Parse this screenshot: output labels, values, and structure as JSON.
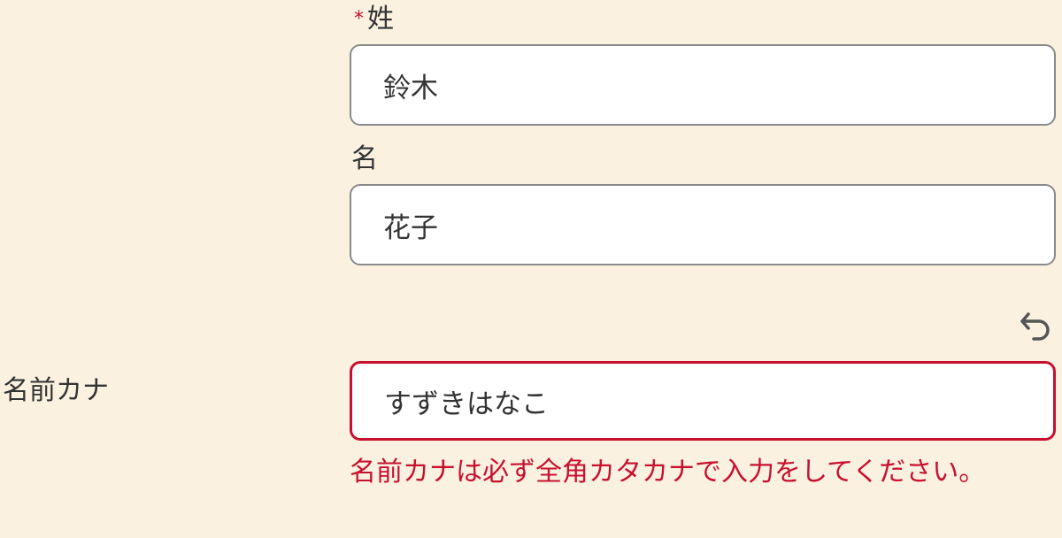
{
  "form": {
    "last_name": {
      "required_mark": "*",
      "label": "姓",
      "value": "鈴木"
    },
    "first_name": {
      "label": "名",
      "value": "花子"
    },
    "kana": {
      "row_label": "名前カナ",
      "value": "すずきはなこ",
      "error": "名前カナは必ず全角カタカナで入力をしてください。",
      "undo_icon": "undo-icon"
    }
  },
  "colors": {
    "background": "#faf1e1",
    "error": "#c8102e",
    "text": "#333333",
    "border": "#8a8a8a"
  }
}
